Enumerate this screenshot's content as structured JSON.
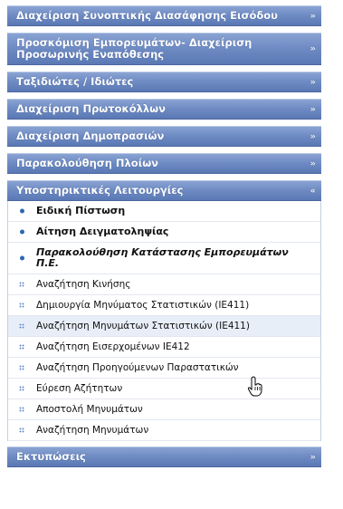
{
  "menu": {
    "sections_top": [
      {
        "label": "Διαχείριση Συνοπτικής Διασάφησης Εισόδου",
        "chevron": "»"
      },
      {
        "label": "Προσκόμιση Εμπορευμάτων- Διαχείριση Προσωρινής Εναπόθεσης",
        "chevron": "»"
      },
      {
        "label": "Ταξιδιώτες / Ιδιώτες",
        "chevron": "»"
      },
      {
        "label": "Διαχείριση Πρωτοκόλλων",
        "chevron": "»"
      },
      {
        "label": "Διαχείριση Δημοπρασιών",
        "chevron": "»"
      },
      {
        "label": "Παρακολούθηση Πλοίων",
        "chevron": "»"
      }
    ],
    "open_section": {
      "label": "Υποστηρικτικές Λειτουργίες",
      "chevron": "«"
    },
    "items": [
      {
        "label": "Ειδική Πίστωση"
      },
      {
        "label": "Αίτηση Δειγματοληψίας"
      },
      {
        "label": "Παρακολούθηση Κατάστασης Εμπορευμάτων Π.Ε."
      },
      {
        "label": "Αναζήτηση Κινήσης"
      },
      {
        "label": "Δημιουργία Μηνύματος Στατιστικών (ΙΕ411)"
      },
      {
        "label": "Αναζήτηση Μηνυμάτων Στατιστικών (ΙΕ411)"
      },
      {
        "label": "Αναζήτηση Εισερχομένων ΙΕ412"
      },
      {
        "label": "Αναζήτηση Προηγούμενων Παραστατικών"
      },
      {
        "label": "Εύρεση Αζήτητων"
      },
      {
        "label": "Αποστολή Μηνυμάτων"
      },
      {
        "label": "Αναζήτηση Μηνυμάτων"
      }
    ],
    "sections_bottom": [
      {
        "label": "Εκτυπώσεις",
        "chevron": "»"
      }
    ]
  },
  "colors": {
    "header": "#6f8cc4",
    "bullet": "#2d66b8",
    "hover_row": "#e8eef8"
  }
}
